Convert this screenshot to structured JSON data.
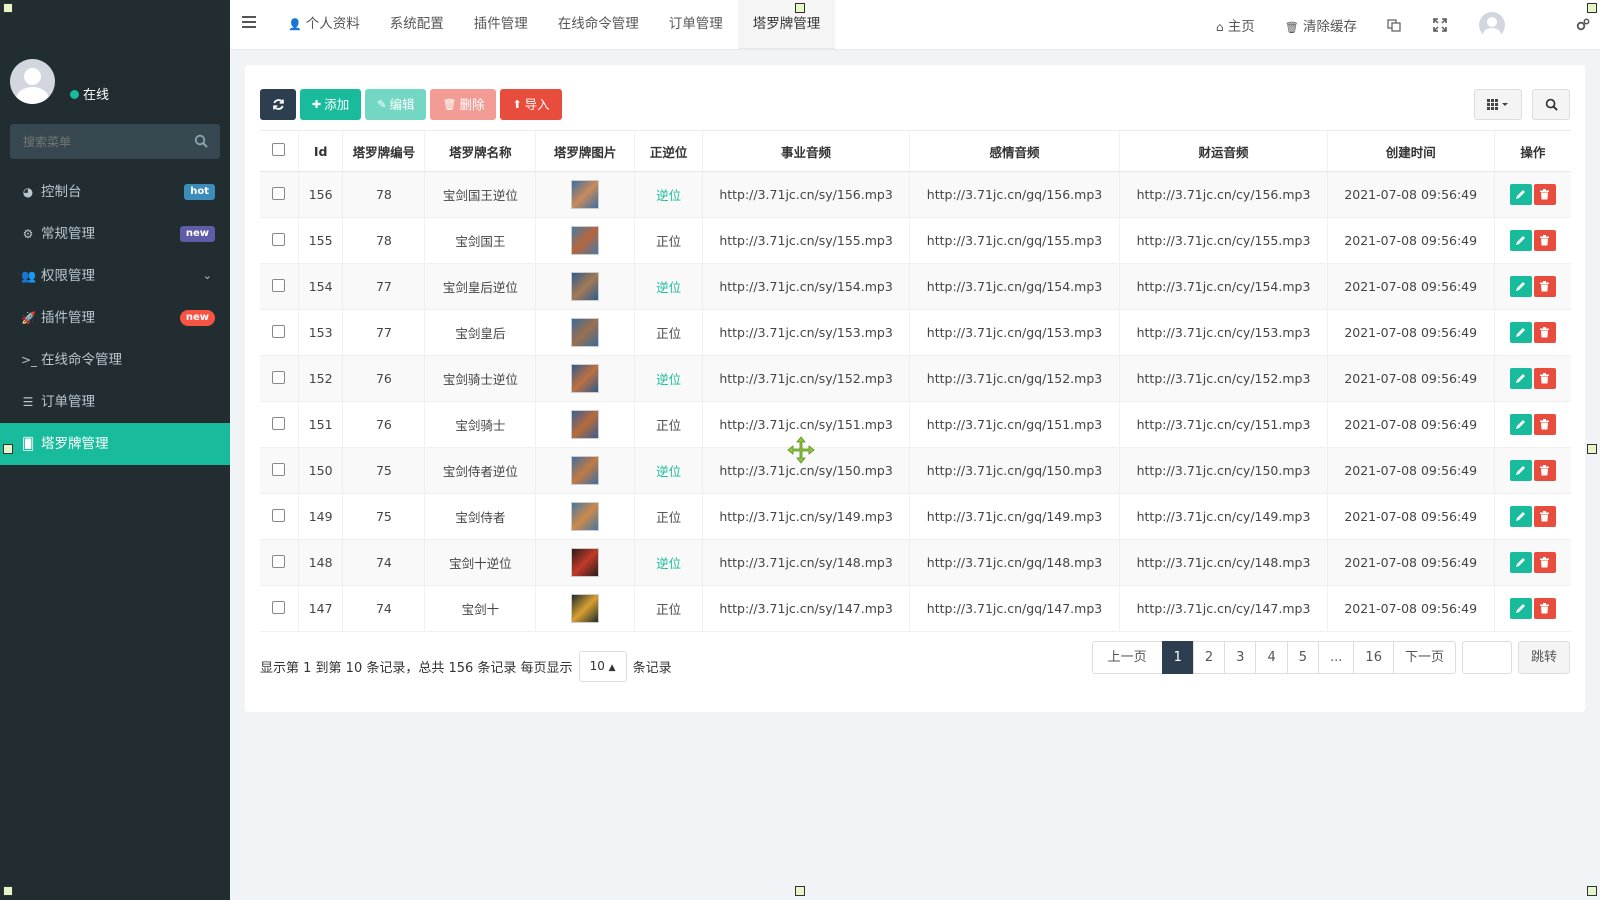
{
  "sidebar": {
    "status": "在线",
    "search_placeholder": "搜索菜单",
    "items": [
      {
        "label": "控制台",
        "icon": "dashboard-icon",
        "badge": "hot"
      },
      {
        "label": "常规管理",
        "icon": "cogs-icon",
        "badge": "new"
      },
      {
        "label": "权限管理",
        "icon": "group-icon",
        "chevron": "⌄"
      },
      {
        "label": "插件管理",
        "icon": "rocket-icon",
        "badge": "new"
      },
      {
        "label": "在线命令管理",
        "icon": "terminal-icon"
      },
      {
        "label": "订单管理",
        "icon": "list-icon"
      },
      {
        "label": "塔罗牌管理",
        "icon": "tarot-icon",
        "active": true
      }
    ]
  },
  "topnav": {
    "tabs": [
      "个人资料",
      "系统配置",
      "插件管理",
      "在线命令管理",
      "订单管理",
      "塔罗牌管理"
    ],
    "home": "主页",
    "clear_cache": "清除缓存"
  },
  "toolbar": {
    "add": "添加",
    "edit": "编辑",
    "delete": "删除",
    "import": "导入"
  },
  "table": {
    "headers": [
      "Id",
      "塔罗牌编号",
      "塔罗牌名称",
      "塔罗牌图片",
      "正逆位",
      "事业音频",
      "感情音频",
      "财运音频",
      "创建时间",
      "操作"
    ],
    "rows": [
      {
        "id": "156",
        "num": "78",
        "name": "宝剑国王逆位",
        "pos": "逆位",
        "sy": "http://3.71jc.cn/sy/156.mp3",
        "gq": "http://3.71jc.cn/gq/156.mp3",
        "cy": "http://3.71jc.cn/cy/156.mp3",
        "time": "2021-07-08 09:56:49"
      },
      {
        "id": "155",
        "num": "78",
        "name": "宝剑国王",
        "pos": "正位",
        "sy": "http://3.71jc.cn/sy/155.mp3",
        "gq": "http://3.71jc.cn/gq/155.mp3",
        "cy": "http://3.71jc.cn/cy/155.mp3",
        "time": "2021-07-08 09:56:49"
      },
      {
        "id": "154",
        "num": "77",
        "name": "宝剑皇后逆位",
        "pos": "逆位",
        "sy": "http://3.71jc.cn/sy/154.mp3",
        "gq": "http://3.71jc.cn/gq/154.mp3",
        "cy": "http://3.71jc.cn/cy/154.mp3",
        "time": "2021-07-08 09:56:49"
      },
      {
        "id": "153",
        "num": "77",
        "name": "宝剑皇后",
        "pos": "正位",
        "sy": "http://3.71jc.cn/sy/153.mp3",
        "gq": "http://3.71jc.cn/gq/153.mp3",
        "cy": "http://3.71jc.cn/cy/153.mp3",
        "time": "2021-07-08 09:56:49"
      },
      {
        "id": "152",
        "num": "76",
        "name": "宝剑骑士逆位",
        "pos": "逆位",
        "sy": "http://3.71jc.cn/sy/152.mp3",
        "gq": "http://3.71jc.cn/gq/152.mp3",
        "cy": "http://3.71jc.cn/cy/152.mp3",
        "time": "2021-07-08 09:56:49"
      },
      {
        "id": "151",
        "num": "76",
        "name": "宝剑骑士",
        "pos": "正位",
        "sy": "http://3.71jc.cn/sy/151.mp3",
        "gq": "http://3.71jc.cn/gq/151.mp3",
        "cy": "http://3.71jc.cn/cy/151.mp3",
        "time": "2021-07-08 09:56:49"
      },
      {
        "id": "150",
        "num": "75",
        "name": "宝剑侍者逆位",
        "pos": "逆位",
        "sy": "http://3.71jc.cn/sy/150.mp3",
        "gq": "http://3.71jc.cn/gq/150.mp3",
        "cy": "http://3.71jc.cn/cy/150.mp3",
        "time": "2021-07-08 09:56:49"
      },
      {
        "id": "149",
        "num": "75",
        "name": "宝剑侍者",
        "pos": "正位",
        "sy": "http://3.71jc.cn/sy/149.mp3",
        "gq": "http://3.71jc.cn/gq/149.mp3",
        "cy": "http://3.71jc.cn/cy/149.mp3",
        "time": "2021-07-08 09:56:49"
      },
      {
        "id": "148",
        "num": "74",
        "name": "宝剑十逆位",
        "pos": "逆位",
        "sy": "http://3.71jc.cn/sy/148.mp3",
        "gq": "http://3.71jc.cn/gq/148.mp3",
        "cy": "http://3.71jc.cn/cy/148.mp3",
        "time": "2021-07-08 09:56:49"
      },
      {
        "id": "147",
        "num": "74",
        "name": "宝剑十",
        "pos": "正位",
        "sy": "http://3.71jc.cn/sy/147.mp3",
        "gq": "http://3.71jc.cn/gq/147.mp3",
        "cy": "http://3.71jc.cn/cy/147.mp3",
        "time": "2021-07-08 09:56:49"
      }
    ]
  },
  "footer": {
    "info": "显示第 1 到第 10 条记录，总共 156 条记录 每页显示",
    "page_size": "10",
    "suffix": "条记录"
  },
  "pagination": {
    "prev": "上一页",
    "pages": [
      "1",
      "2",
      "3",
      "4",
      "5",
      "...",
      "16"
    ],
    "current": "1",
    "next": "下一页",
    "jump": "跳转"
  },
  "colors": {
    "sidebar_bg": "#222d32",
    "accent": "#18bc9c",
    "dark_btn": "#2c3e50",
    "danger": "#e74c3c"
  }
}
